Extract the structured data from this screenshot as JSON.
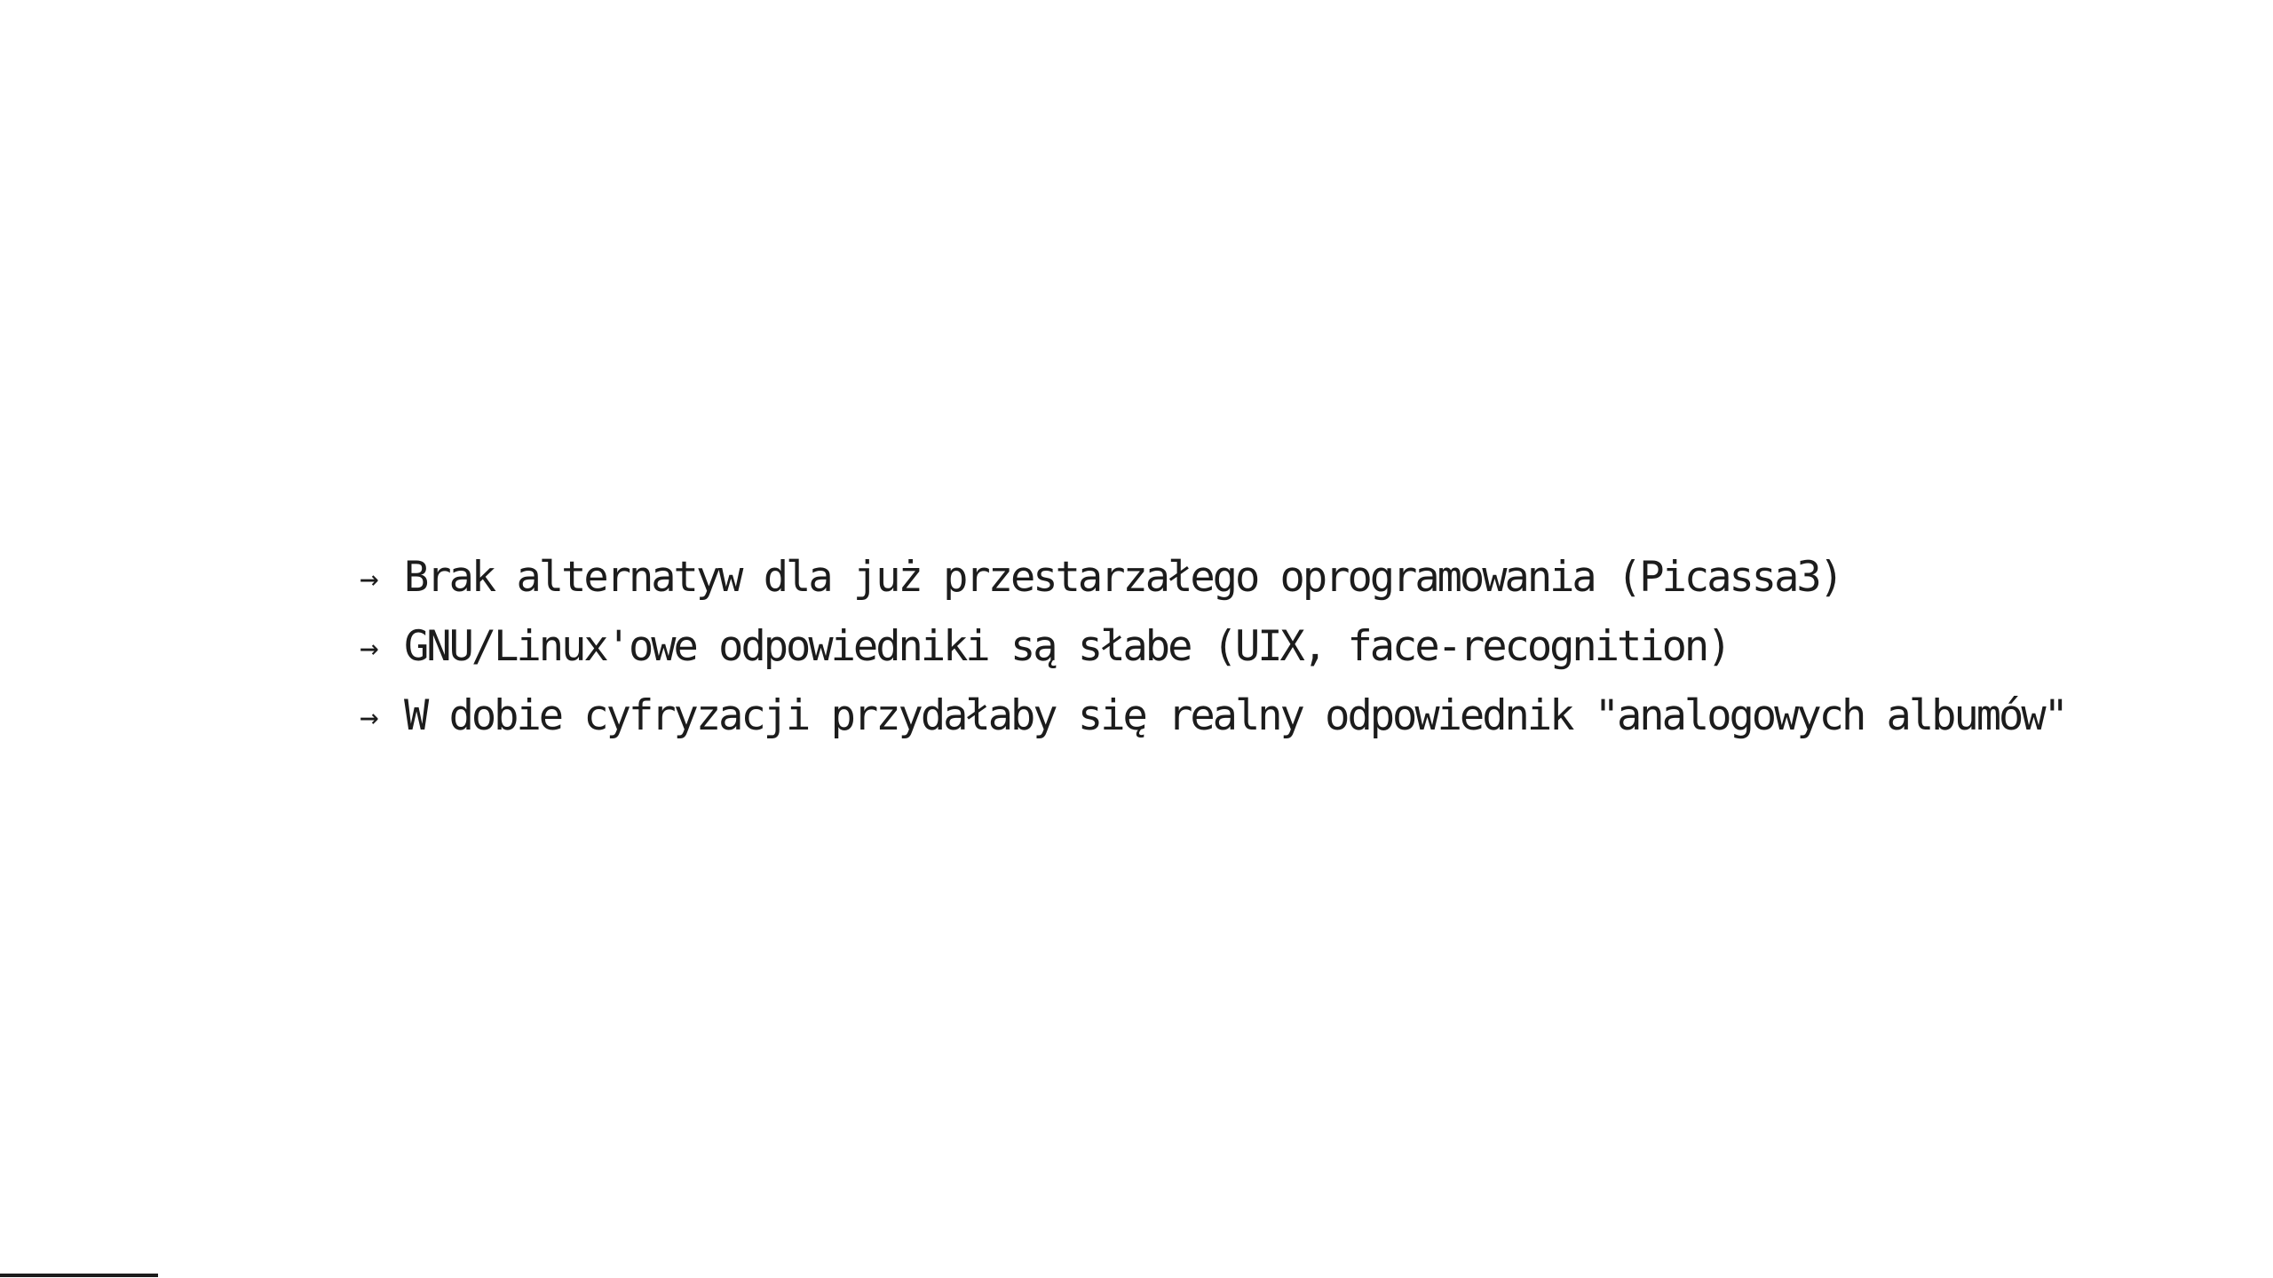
{
  "slide": {
    "bullet_marker": "→",
    "bullets": [
      "Brak alternatyw dla już przestarzałego oprogramowania (Picassa3)",
      "GNU/Linux'owe odpowiedniki są słabe (UIX, face-recognition)",
      "W dobie cyfryzacji przydałaby się realny odpowiednik \"analogowych albumów\""
    ]
  }
}
